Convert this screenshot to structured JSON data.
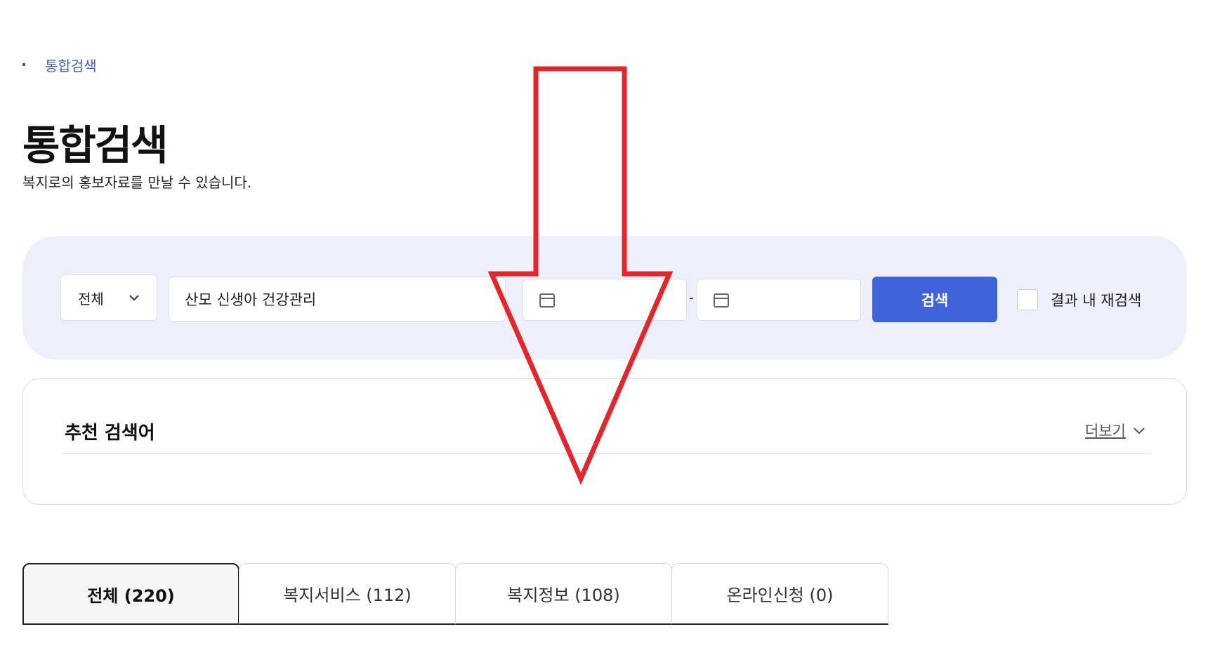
{
  "breadcrumb": {
    "current": "통합검색"
  },
  "header": {
    "title": "통합검색",
    "description": "복지로의 홍보자료를 만날 수 있습니다."
  },
  "search": {
    "category_selected": "전체",
    "keyword_value": "산모 신생아 건강관리",
    "date_separator": "-",
    "submit_label": "검색",
    "re_search_label": "결과 내 재검색",
    "re_search_checked": false
  },
  "recommended": {
    "title": "추천 검색어",
    "more_label": "더보기"
  },
  "tabs": [
    {
      "label": "전체  (220)",
      "active": true
    },
    {
      "label": "복지서비스 (112)",
      "active": false
    },
    {
      "label": "복지정보 (108)",
      "active": false
    },
    {
      "label": "온라인신청 (0)",
      "active": false
    }
  ],
  "annotation": {
    "arrow_color": "#e8242b"
  },
  "colors": {
    "accent": "#3f63d8",
    "panel_bg": "#edf0fa",
    "breadcrumb_link": "#3d5fd1"
  }
}
